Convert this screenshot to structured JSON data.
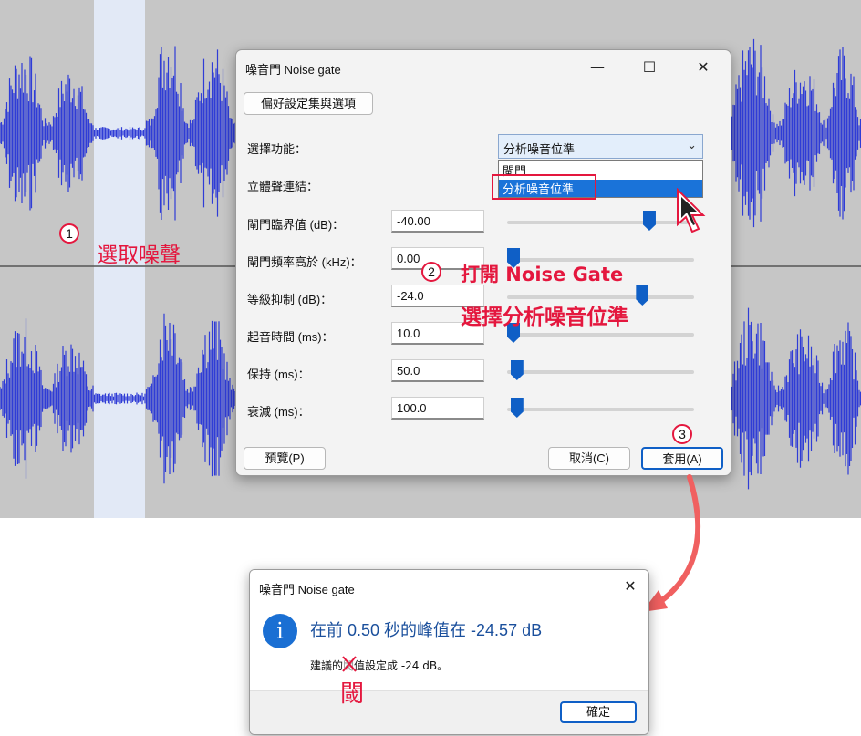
{
  "colors": {
    "wave": "#2f3cd6",
    "accent": "#0f5fc6",
    "annotation": "#e4173e",
    "info_icon": "#1a6fd3"
  },
  "main_dialog": {
    "title": "噪音門 Noise gate",
    "preset_button": "偏好設定集與選項",
    "function_label": "選擇功能：",
    "function_selected": "分析噪音位準",
    "function_options": [
      "閘門",
      "分析噪音位準"
    ],
    "stereo_label": "立體聲連結：",
    "params": [
      {
        "label": "閘門臨界值 (dB)：",
        "value": "-40.00",
        "level": 0.78
      },
      {
        "label": "閘門頻率高於 (kHz)：",
        "value": "0.00",
        "level": 0.0
      },
      {
        "label": "等級抑制 (dB)：",
        "value": "-24.0",
        "level": 0.74
      },
      {
        "label": "起音時間 (ms)：",
        "value": "10.0",
        "level": 0.0
      },
      {
        "label": "保持 (ms)：",
        "value": "50.0",
        "level": 0.02
      },
      {
        "label": "衰減 (ms)：",
        "value": "100.0",
        "level": 0.02
      }
    ],
    "preview_button": "預覽(P)",
    "cancel_button": "取消(C)",
    "apply_button": "套用(A)"
  },
  "result_dialog": {
    "title": "噪音門 Noise gate",
    "headline": "在前 0.50 秒的峰值在 -24.57 dB",
    "message_prefix": "建議的",
    "message_struck": "閥",
    "message_suffix": "值設定成 -24 dB。",
    "ok_button": "確定"
  },
  "annotations": {
    "step1_num": "1",
    "step1_text": "選取噪聲",
    "step2_num": "2",
    "step2_line1": "打開 Noise Gate",
    "step2_line2": "選擇分析噪音位準",
    "step3_num": "3",
    "correction": "閾"
  }
}
